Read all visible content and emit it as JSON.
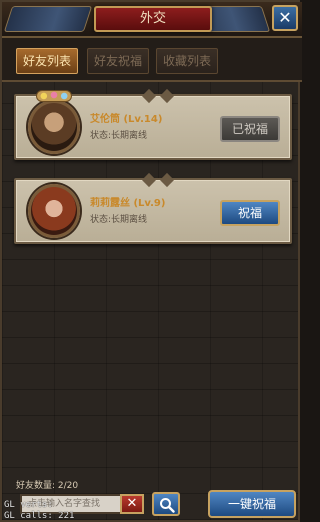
{
  "header": {
    "title": "外交",
    "close_label": "✕"
  },
  "tabs": [
    {
      "label": "好友列表",
      "active": true
    },
    {
      "label": "好友祝福",
      "active": false
    },
    {
      "label": "收藏列表",
      "active": false
    }
  ],
  "friends": [
    {
      "name": "艾伦筒 (Lv.14)",
      "status": "状态:长期离线",
      "bless_label": "已祝福",
      "blessed": true
    },
    {
      "name": "莉莉露丝 (Lv.9)",
      "status": "状态:长期离线",
      "bless_label": "祝福",
      "blessed": false
    }
  ],
  "footer": {
    "friend_count": "好友数量: 2/20",
    "search_placeholder": "点击输入名字查找",
    "clear_label": "✕",
    "bless_all_label": "一键祝福"
  },
  "debug": {
    "gl_line1": "GL verts:   ",
    "gl_line2": "GL calls:  221"
  },
  "colors": {
    "accent_gold": "#c6a260",
    "title_red": "#8d1d1d",
    "button_blue": "#1e4a80",
    "name_orange": "#c9892b"
  }
}
